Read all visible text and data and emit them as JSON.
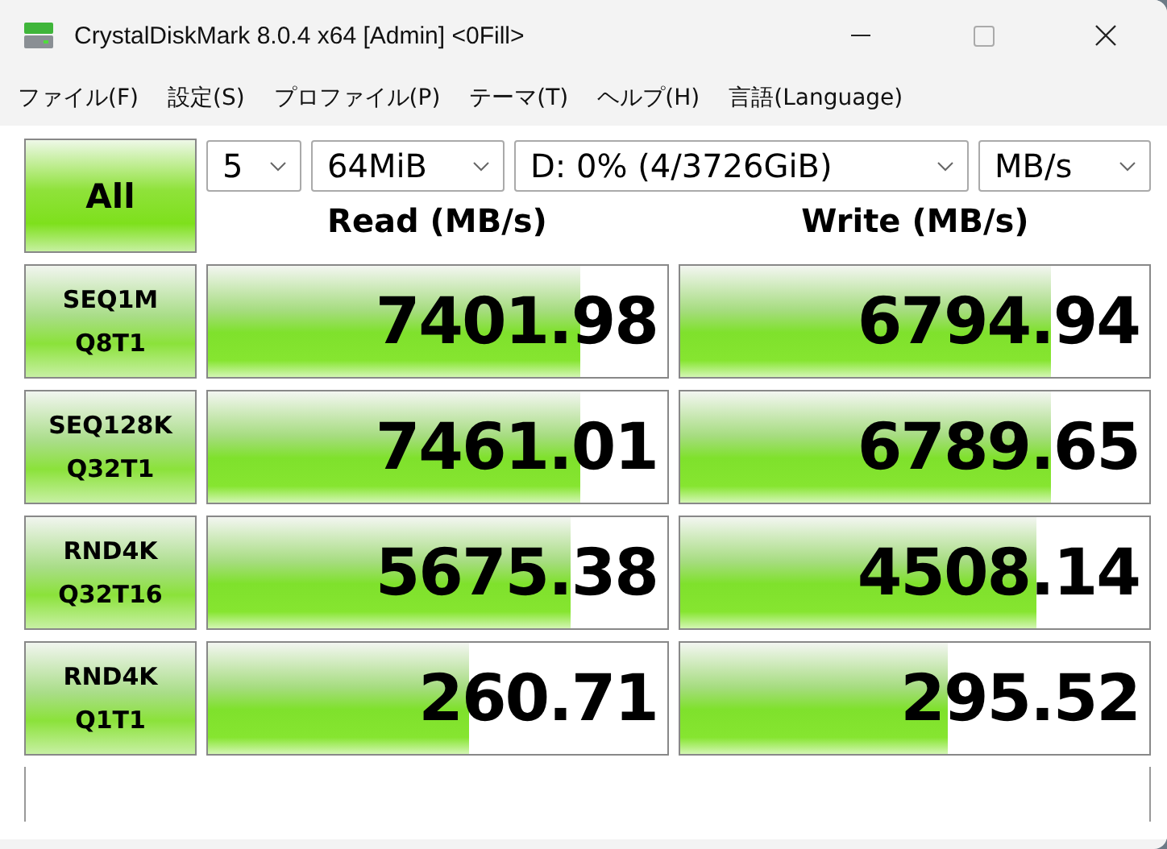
{
  "window": {
    "title": "CrystalDiskMark 8.0.4 x64 [Admin] <0Fill>"
  },
  "menu": [
    "ファイル(F)",
    "設定(S)",
    "プロファイル(P)",
    "テーマ(T)",
    "ヘルプ(H)",
    "言語(Language)"
  ],
  "all_button": "All",
  "dropdowns": [
    {
      "value": "5"
    },
    {
      "value": "64MiB"
    },
    {
      "value": "D: 0% (4/3726GiB)"
    },
    {
      "value": "MB/s"
    }
  ],
  "headers": [
    "Read (MB/s)",
    "Write (MB/s)"
  ],
  "tests": [
    {
      "line1": "SEQ1M",
      "line2": "Q8T1",
      "read": {
        "value": "7401.98",
        "level": 0.81
      },
      "write": {
        "value": "6794.94",
        "level": 0.79
      }
    },
    {
      "line1": "SEQ128K",
      "line2": "Q32T1",
      "read": {
        "value": "7461.01",
        "level": 0.81
      },
      "write": {
        "value": "6789.65",
        "level": 0.79
      }
    },
    {
      "line1": "RND4K",
      "line2": "Q32T16",
      "read": {
        "value": "5675.38",
        "level": 0.79
      },
      "write": {
        "value": "4508.14",
        "level": 0.76
      }
    },
    {
      "line1": "RND4K",
      "line2": "Q1T1",
      "read": {
        "value": "260.71",
        "level": 0.57
      },
      "write": {
        "value": "295.52",
        "level": 0.57
      }
    }
  ]
}
